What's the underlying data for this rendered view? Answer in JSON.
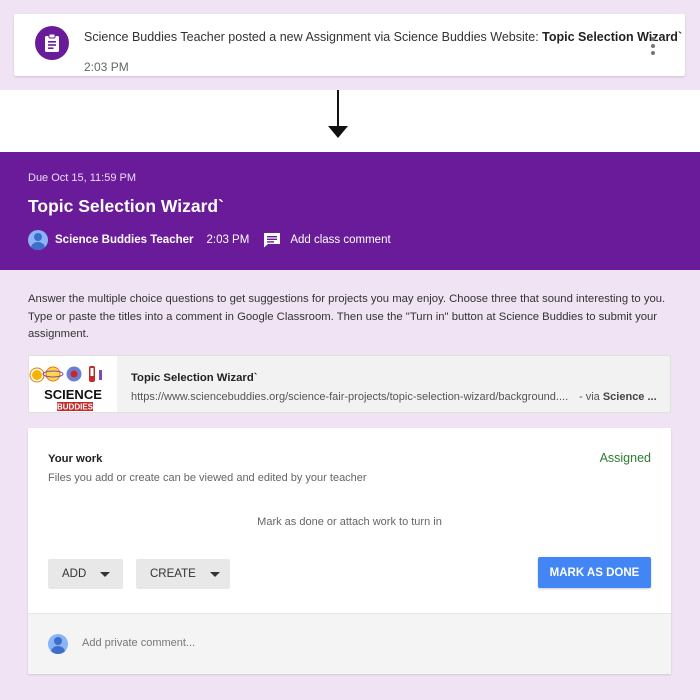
{
  "notification": {
    "prefix": "Science Buddies Teacher posted a new Assignment via Science Buddies Website: ",
    "assignment": "Topic Selection Wizard`",
    "time": "2:03 PM",
    "avatar_icon": "assignment-icon",
    "menu_icon": "more-vert-icon"
  },
  "assignment": {
    "due": "Due Oct 15, 11:59 PM",
    "title": "Topic Selection Wizard`",
    "author": "Science Buddies Teacher",
    "time": "2:03 PM",
    "add_comment": "Add class comment",
    "description": "Answer the multiple choice questions to get suggestions for projects you may enjoy. Choose three that sound interesting to you. Type or paste the titles into a comment in Google Classroom. Then use the \"Turn in\" button at Science Buddies to submit your assignment."
  },
  "attachment": {
    "title": "Topic Selection Wizard`",
    "url": "https://www.sciencebuddies.org/science-fair-projects/topic-selection-wizard/background....",
    "via_prefix": "- via ",
    "via_source": "Science ...",
    "thumb_text_1": "SCIENCE",
    "thumb_text_2": "BUDDIES"
  },
  "your_work": {
    "title": "Your work",
    "subtitle": "Files you add or create can be viewed and edited by your teacher",
    "status": "Assigned",
    "hint": "Mark as done or attach work to turn in",
    "add_label": "ADD",
    "create_label": "CREATE",
    "done_label": "MARK AS DONE",
    "private_placeholder": "Add private comment..."
  },
  "colors": {
    "purple": "#6a1b9a",
    "background": "#f0e3f4",
    "status_green": "#2e7d32",
    "button_blue": "#4285f4"
  }
}
